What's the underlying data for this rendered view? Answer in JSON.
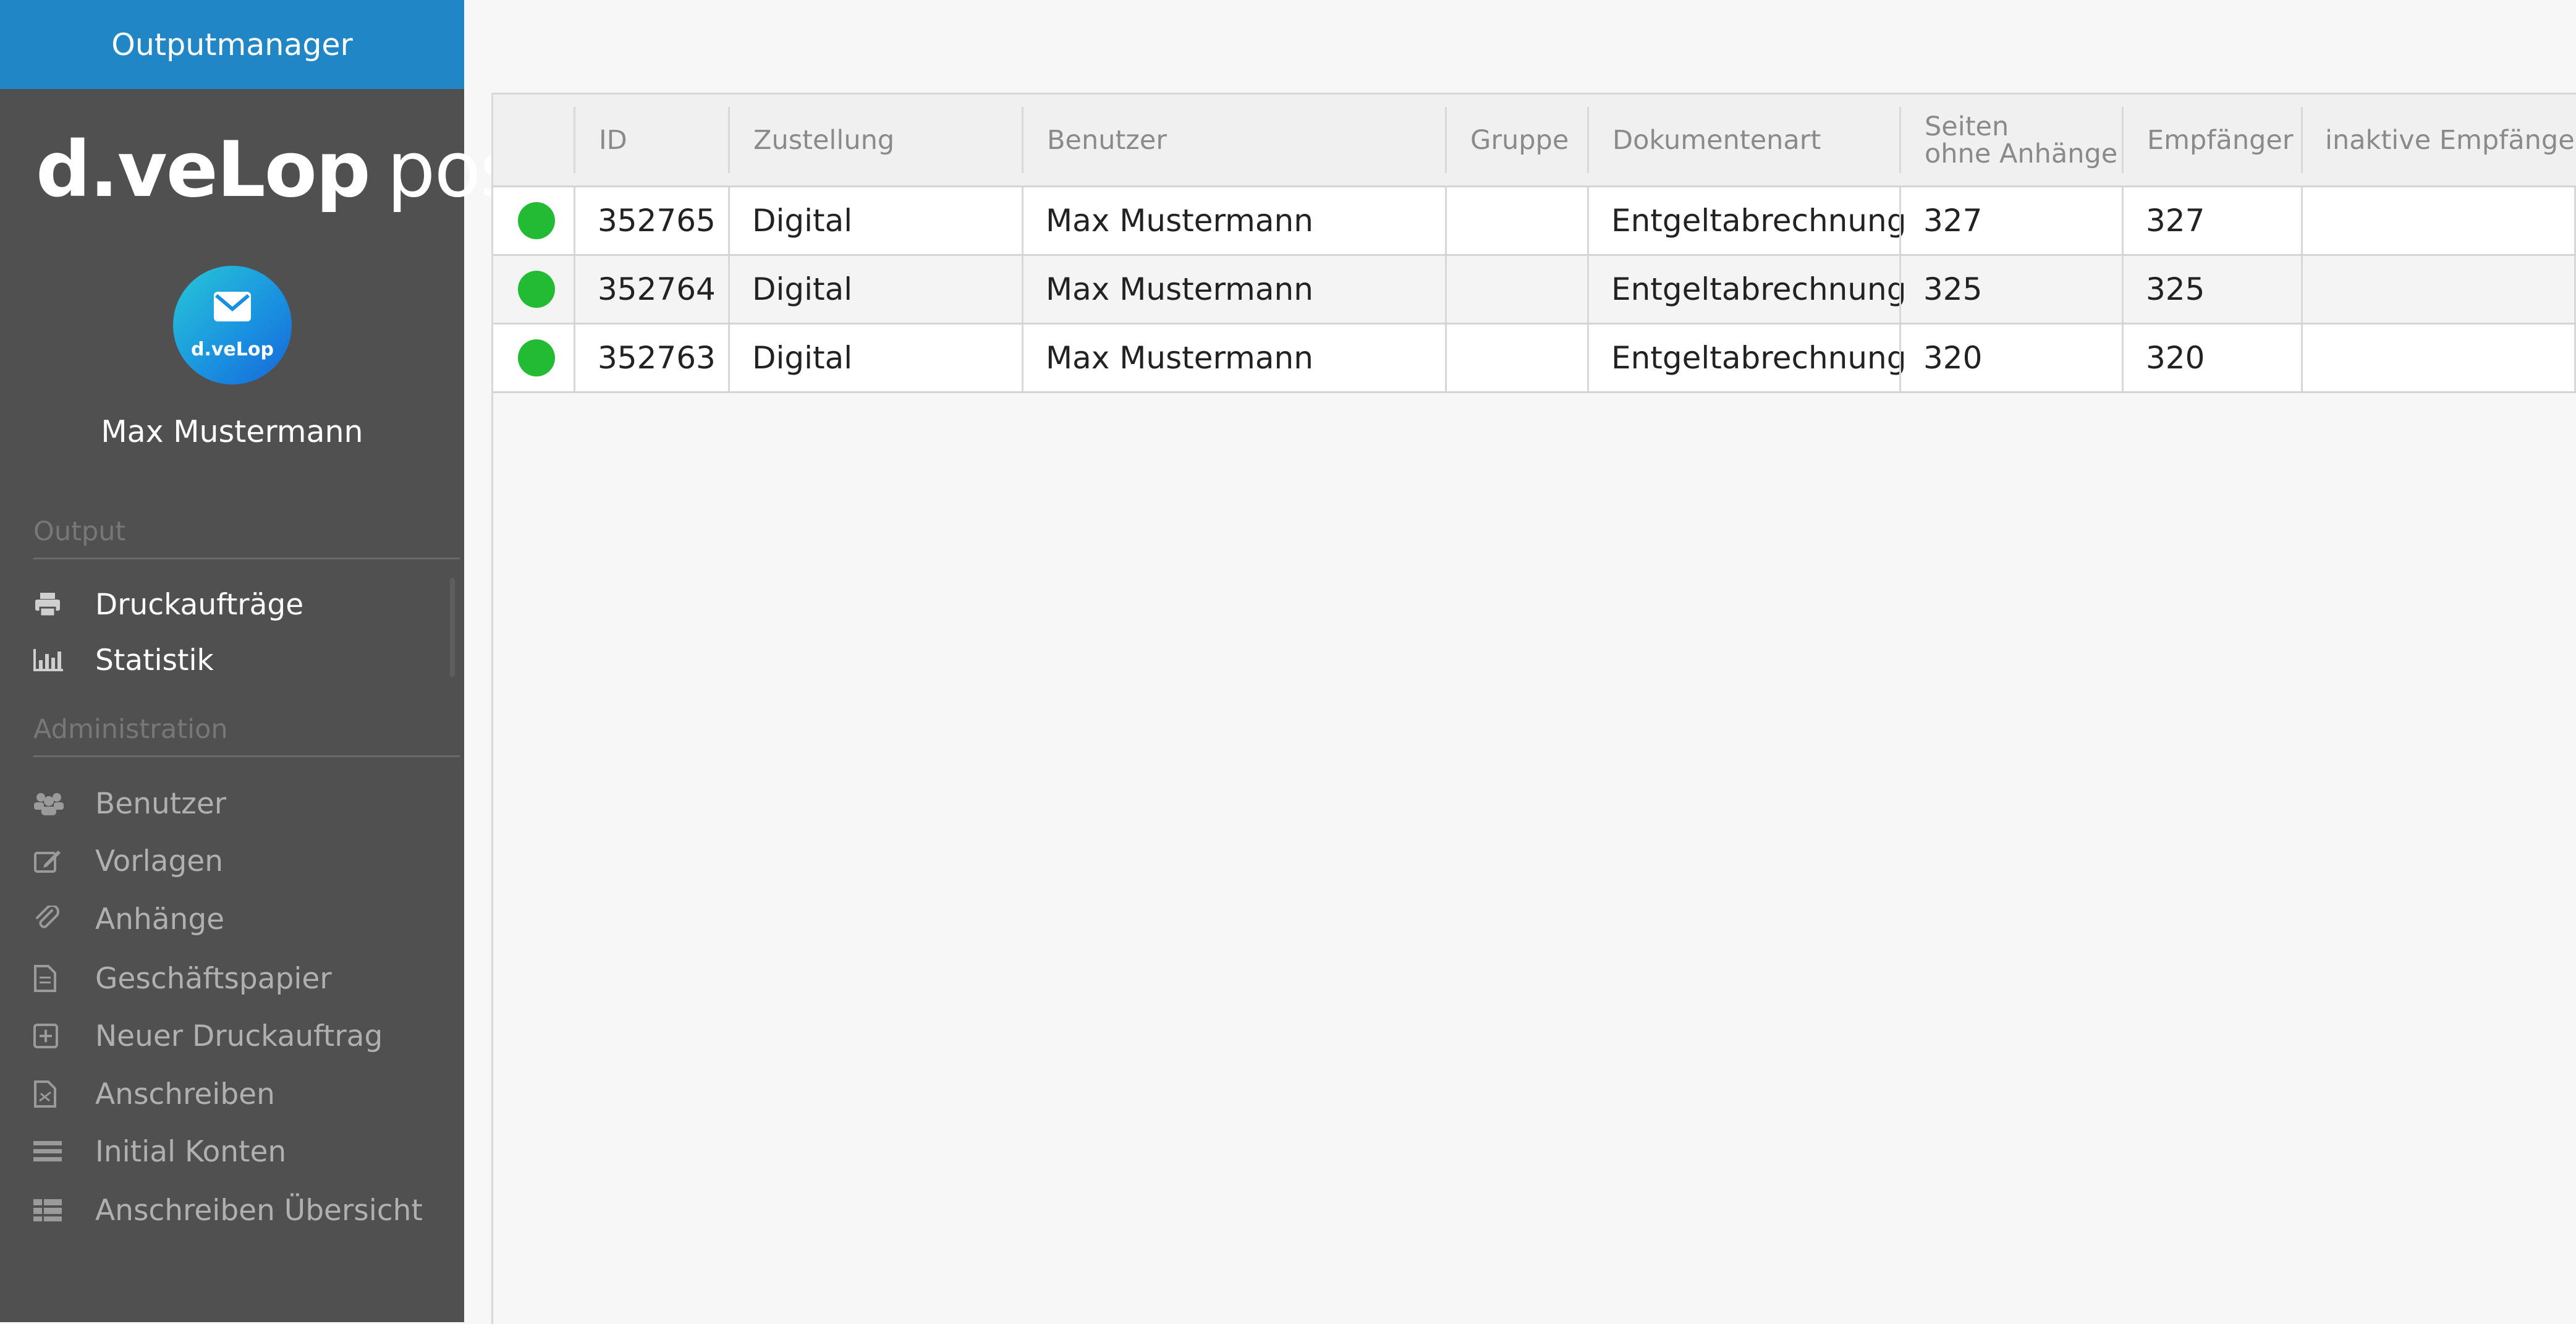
{
  "app": {
    "title": "Outputmanager",
    "logo_brand": "d.veLop",
    "logo_product": "post",
    "avatar_label": "d.veLop",
    "user_name": "Max Mustermann"
  },
  "sidebar": {
    "output_title": "Output",
    "output_items": [
      {
        "label": "Druckaufträge",
        "icon": "printer-icon"
      },
      {
        "label": "Statistik",
        "icon": "bar-chart-icon"
      }
    ],
    "admin_title": "Administration",
    "admin_items": [
      {
        "label": "Benutzer",
        "icon": "users-icon"
      },
      {
        "label": "Vorlagen",
        "icon": "edit-icon"
      },
      {
        "label": "Anhänge",
        "icon": "paperclip-icon"
      },
      {
        "label": "Geschäftspapier",
        "icon": "document-icon"
      },
      {
        "label": "Neuer Druckauftrag",
        "icon": "plus-square-icon"
      },
      {
        "label": "Anschreiben",
        "icon": "pdf-file-icon"
      },
      {
        "label": "Initial Konten",
        "icon": "list-icon"
      },
      {
        "label": "Anschreiben Übersicht",
        "icon": "table-icon"
      }
    ]
  },
  "table": {
    "columns": [
      "",
      "ID",
      "Zustellung",
      "Benutzer",
      "Gruppe",
      "Dokumentenart",
      "Seiten",
      "ohne Anhänge",
      "Empfänger",
      "inaktive Empfänger"
    ],
    "rows": [
      {
        "status": "green",
        "id": "352765",
        "zustellung": "Digital",
        "benutzer": "Max Mustermann",
        "gruppe": "",
        "dokumentenart": "Entgeltabrechnung",
        "seiten": "327",
        "empfaenger": "327",
        "inaktive": ""
      },
      {
        "status": "green",
        "id": "352764",
        "zustellung": "Digital",
        "benutzer": "Max Mustermann",
        "gruppe": "",
        "dokumentenart": "Entgeltabrechnung",
        "seiten": "325",
        "empfaenger": "325",
        "inaktive": ""
      },
      {
        "status": "green",
        "id": "352763",
        "zustellung": "Digital",
        "benutzer": "Max Mustermann",
        "gruppe": "",
        "dokumentenart": "Entgeltabrechnung",
        "seiten": "320",
        "empfaenger": "320",
        "inaktive": ""
      }
    ]
  },
  "colors": {
    "header_blue": "#2186c6",
    "sidebar_bg": "#505050",
    "status_green": "#22bb33"
  }
}
